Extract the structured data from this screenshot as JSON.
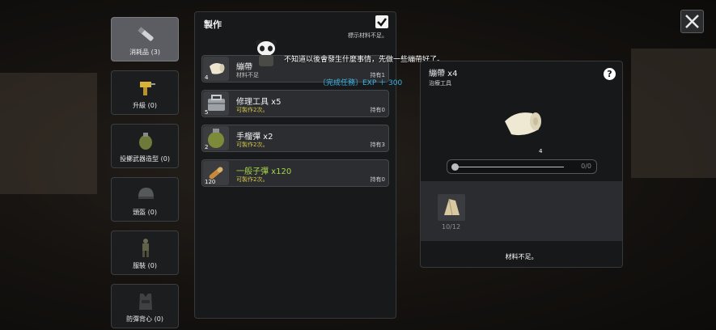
{
  "categories": [
    {
      "label": "消耗品 (3)",
      "icon": "ammo-icon",
      "active": true
    },
    {
      "label": "升級 (0)",
      "icon": "drill-icon",
      "active": false
    },
    {
      "label": "投擲武器造型 (0)",
      "icon": "grenade-icon",
      "active": false
    },
    {
      "label": "頭盔 (0)",
      "icon": "helmet-icon",
      "active": false
    },
    {
      "label": "服裝 (0)",
      "icon": "soldier-outfit-icon",
      "active": false
    },
    {
      "label": "防彈背心 (0)",
      "icon": "vest-icon",
      "active": false
    }
  ],
  "crafting": {
    "title": "製作",
    "filter_label": "標示材料不足。",
    "items": [
      {
        "name": "繃帶",
        "status": "材料不足",
        "have": "持有1",
        "qty": "4",
        "icon": "bandage-icon"
      },
      {
        "name": "修理工具  x5",
        "status": "可製作2次。",
        "have": "持有0",
        "qty": "5",
        "icon": "toolbox-icon"
      },
      {
        "name": "手榴彈  x2",
        "status": "可製作2次。",
        "have": "持有3",
        "qty": "2",
        "icon": "grenade-icon"
      },
      {
        "name": "一般子彈  x120",
        "status": "可製作2次。",
        "have": "持有0",
        "qty": "120",
        "icon": "bullet-icon"
      }
    ]
  },
  "tooltip": {
    "text": "不知道以後會發生什麼事情，先做一些繃帶好了。",
    "quest": "〔完成任務〕EXP ＋ 300"
  },
  "detail": {
    "title": "繃帶  x4",
    "subtitle": "治療工具",
    "count": "4",
    "slider_value": "0/0",
    "material_count": "10/12",
    "footer": "材料不足。"
  },
  "colors": {
    "accent_green": "#a8d44a",
    "status_yellow": "#d8c94a",
    "quest_blue": "#3ab3e6"
  }
}
